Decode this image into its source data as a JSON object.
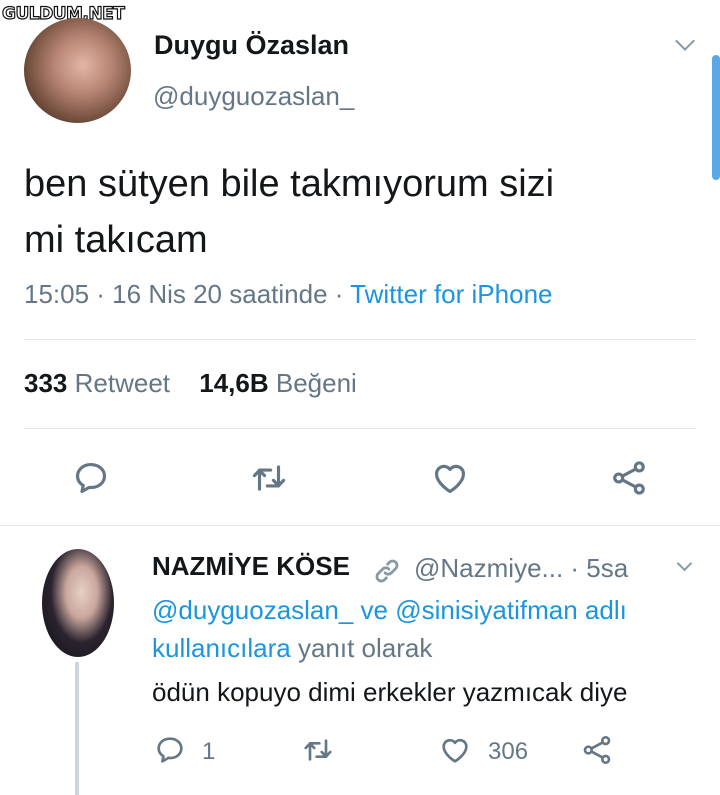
{
  "watermark": "GULDUM.NET",
  "tweet": {
    "author_name": "Duygu Özaslan",
    "author_handle": "@duyguozaslan_",
    "text_line1": "ben sütyen bile takmıyorum sizi",
    "text_line2": "mi takıcam",
    "time": "15:05 · 16 Nis 20 saatinde · ",
    "source": "Twitter for iPhone",
    "retweet_count": "333",
    "retweet_label": "Retweet",
    "like_count": "14,6B",
    "like_label": "Beğeni"
  },
  "reply": {
    "author_name": "NAZMİYE KÖSE",
    "author_handle": "@Nazmiye... · 5sa",
    "mention1": "@duyguozaslan_",
    "conj": " ve ",
    "mention2": "@sinisiyatifman adlı",
    "mention3": "kullanıcılara",
    "reply_suffix": " yanıt olarak",
    "text": "ödün kopuyo dimi erkekler yazmıcak diye",
    "reply_count": "1",
    "like_count": "306"
  },
  "icons": [
    "reply-icon",
    "retweet-icon",
    "like-icon",
    "share-icon",
    "link-icon",
    "chevron-down-icon"
  ],
  "colors": {
    "link": "#1b95e0",
    "secondary": "#657786",
    "text": "#14171a",
    "scrollbar": "#5aa9e6"
  }
}
